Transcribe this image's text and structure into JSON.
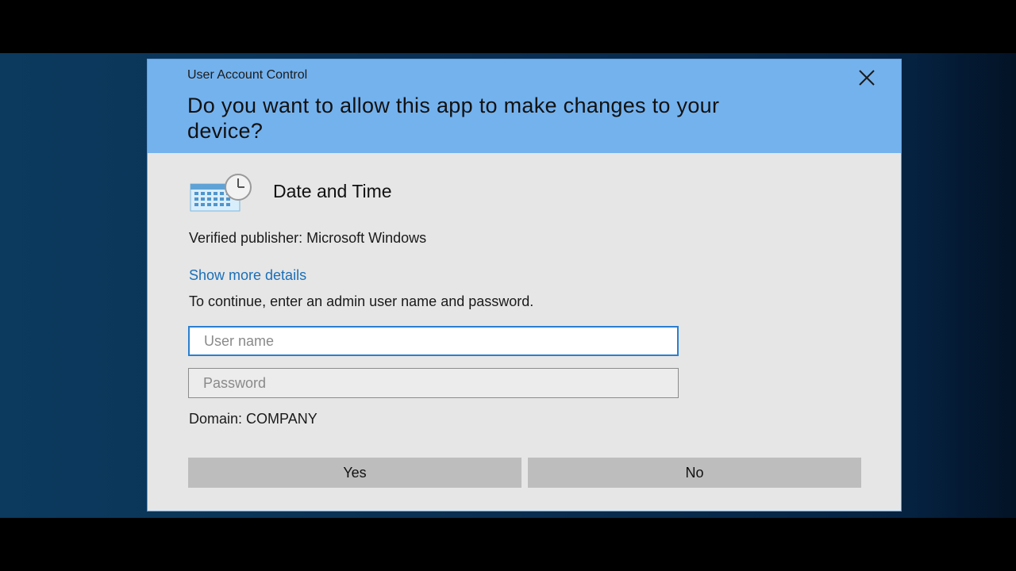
{
  "dialog": {
    "title": "User Account Control",
    "question": "Do you want to allow this app to make changes to your device?",
    "close_icon": "close-icon",
    "app": {
      "icon": "calendar-clock-icon",
      "name": "Date and Time"
    },
    "publisher": "Verified publisher: Microsoft Windows",
    "details_link": "Show more details",
    "instructions": "To continue, enter an admin user name and password.",
    "username": {
      "value": "",
      "placeholder": "User name"
    },
    "password": {
      "value": "",
      "placeholder": "Password"
    },
    "domain": "Domain: COMPANY",
    "buttons": {
      "yes": "Yes",
      "no": "No"
    }
  },
  "colors": {
    "header_bg": "#74b2ee",
    "body_bg": "#e6e6e6",
    "link": "#1a6fb8",
    "focus_border": "#2a7fd0",
    "button_bg": "#bdbdbd",
    "desktop_bg": "#0a2f52"
  }
}
